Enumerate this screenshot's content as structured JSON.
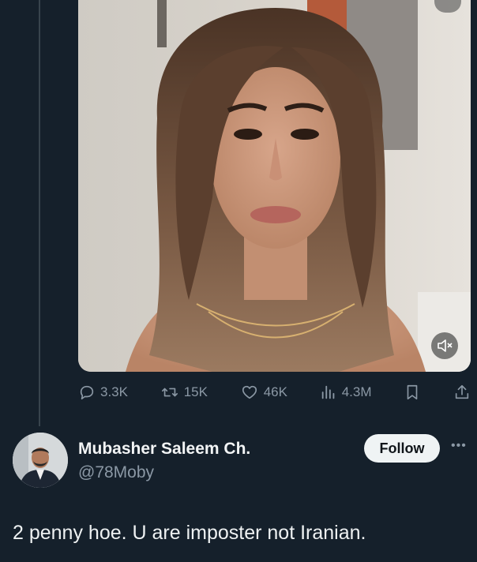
{
  "post": {
    "media": {
      "mute_icon": "speaker-muted-icon"
    },
    "actions": {
      "replies": "3.3K",
      "reposts": "15K",
      "likes": "46K",
      "views": "4.3M"
    }
  },
  "reply": {
    "display_name": "Mubasher Saleem Ch.",
    "handle": "@78Moby",
    "follow_label": "Follow",
    "more_label": "•••",
    "text": "2 penny hoe. U are imposter not Iranian."
  },
  "colors": {
    "background": "#15202b",
    "text_primary": "#e7e9ea",
    "text_secondary": "#8b98a5",
    "follow_bg": "#eff3f4"
  }
}
